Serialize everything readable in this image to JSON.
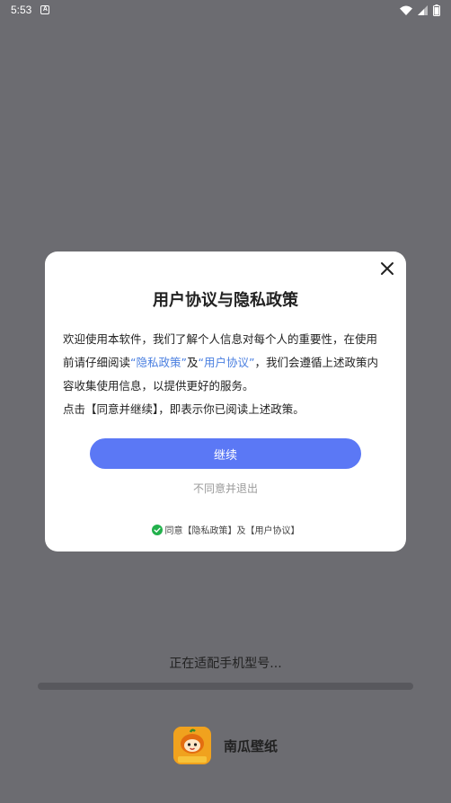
{
  "status_bar": {
    "time": "5:53",
    "app_notification_glyph": "A"
  },
  "dialog": {
    "title": "用户协议与隐私政策",
    "body": {
      "p1_text1": "欢迎使用本软件，我们了解个人信息对每个人的重要性，在使用前请仔细阅读",
      "privacy_link": "“隐私政策”",
      "conj": "及",
      "user_link": "“用户协议”",
      "p1_text2": "，我们会遵循上述政策内容收集使用信息，以提供更好的服务。",
      "p2": "点击【同意并继续】，即表示你已阅读上述政策。"
    },
    "continue_label": "继续",
    "decline_label": "不同意并退出",
    "agree_text": "同意【隐私政策】及【用户协议】"
  },
  "loading": {
    "text": "正在适配手机型号...",
    "progress_percent": 0
  },
  "brand": {
    "app_name": "南瓜壁纸",
    "logo_caption": "南瓜壁纸"
  },
  "colors": {
    "accent": "#5b78f5",
    "link": "#4a7fe0",
    "check": "#22b14c",
    "overlay": "#6c6c71"
  }
}
